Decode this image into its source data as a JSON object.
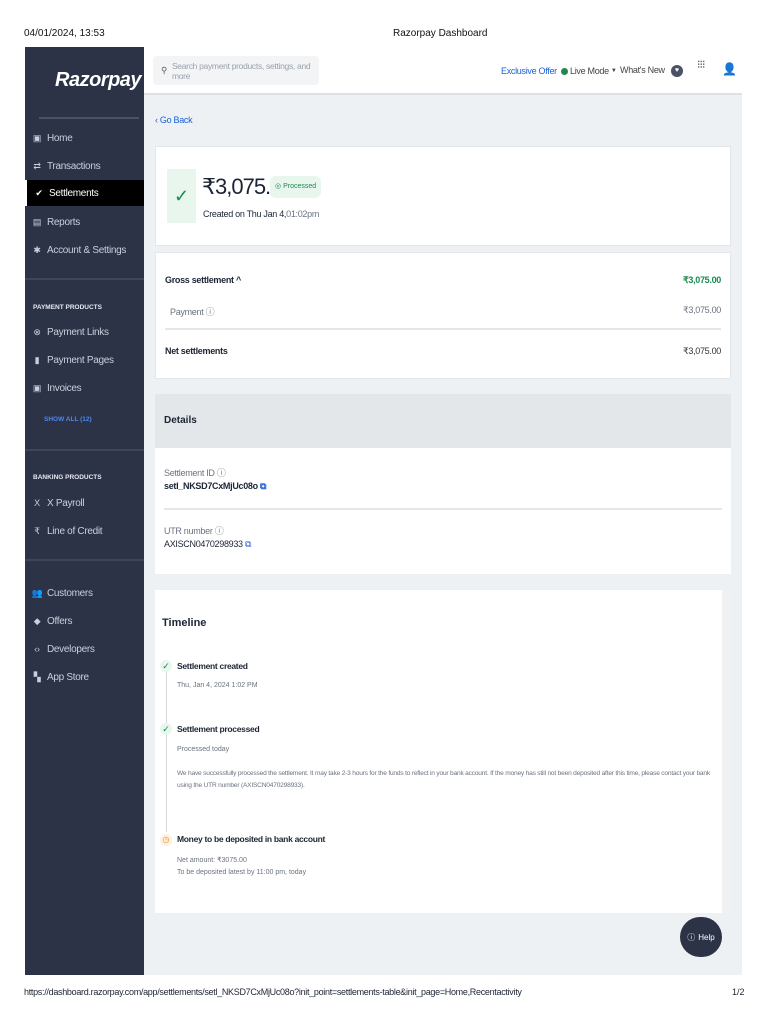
{
  "page_header": {
    "datetime": "04/01/2024, 13:53",
    "title": "Razorpay Dashboard"
  },
  "page_footer": {
    "url": "https://dashboard.razorpay.com/app/settlements/setl_NKSD7CxMjUc08o?init_point=settlements-table&init_page=Home,Recentactivity",
    "page": "1/2"
  },
  "sidebar": {
    "logo": "Razorpay",
    "items": [
      {
        "label": "Home",
        "icon": "home-icon"
      },
      {
        "label": "Transactions",
        "icon": "transactions-icon"
      },
      {
        "label": "Settlements",
        "icon": "check-icon",
        "active": true
      },
      {
        "label": "Reports",
        "icon": "reports-icon"
      },
      {
        "label": "Account & Settings",
        "icon": "gear-icon"
      }
    ],
    "payment_products_title": "PAYMENT PRODUCTS",
    "payment_products": [
      {
        "label": "Payment Links"
      },
      {
        "label": "Payment Pages"
      },
      {
        "label": "Invoices"
      }
    ],
    "show_all": "SHOW ALL (12)",
    "banking_products_title": "BANKING PRODUCTS",
    "banking_products": [
      {
        "label": "X Payroll"
      },
      {
        "label": "Line of Credit"
      }
    ],
    "more": [
      {
        "label": "Customers"
      },
      {
        "label": "Offers"
      },
      {
        "label": "Developers"
      },
      {
        "label": "App Store"
      }
    ]
  },
  "topbar": {
    "search_placeholder": "Search payment products, settings, and more",
    "exclusive_offer": "Exclusive Offer",
    "live_mode": "Live Mode",
    "whats_new": "What's New"
  },
  "go_back": "Go Back",
  "summary": {
    "amount": "₹3,075.00",
    "status": "Processed",
    "created": "Created on Thu Jan 4,",
    "created_time": "01:02pm"
  },
  "breakdown": {
    "gross_label": "Gross settlement",
    "gross_value": "₹3,075.00",
    "payment_label": "Payment",
    "payment_value": "₹3,075.00",
    "net_label": "Net settlements",
    "net_value": "₹3,075.00"
  },
  "details": {
    "title": "Details",
    "settlement_id_label": "Settlement ID",
    "settlement_id": "setl_NKSD7CxMjUc08o",
    "utr_label": "UTR number",
    "utr": "AXISCN0470298933"
  },
  "timeline": {
    "title": "Timeline",
    "steps": [
      {
        "title": "Settlement created",
        "lines": [
          "Thu, Jan 4, 2024 1:02 PM"
        ]
      },
      {
        "title": "Settlement processed",
        "lines": [
          "Processed today"
        ],
        "note": "We have successfully processed the settlement. It may take 2-3 hours for the funds to reflect in your bank account. If the money has still not been deposited after this time, please contact your bank using the UTR number (AXISCN0470298933)."
      },
      {
        "title": "Money to be deposited in bank account",
        "lines": [
          "Net amount: ₹3075.00",
          "To be deposited latest by 11:00 pm, today"
        ]
      }
    ]
  },
  "help": "Help",
  "colors": {
    "sidebar": "#2d3347",
    "accent": "#1a5fd8",
    "success": "#1b8a4c",
    "pending": "#e8962e"
  }
}
